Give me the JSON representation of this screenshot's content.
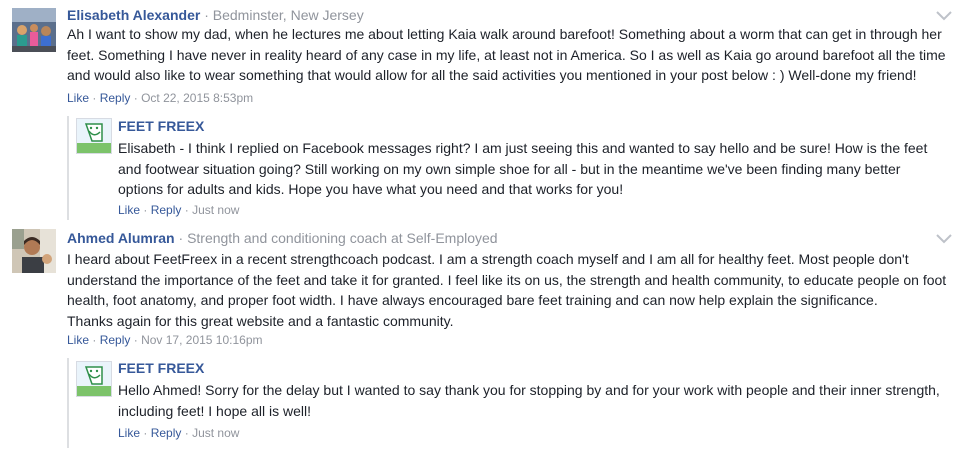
{
  "comments": [
    {
      "author": "Elisabeth Alexander",
      "separator": "·",
      "meta": "Bedminster, New Jersey",
      "text": "Ah I want to show my dad, when he lectures me about letting Kaia walk around barefoot! Something about a worm that can get in through her feet. Something I have never in reality heard of any case in my life, at least not in America. So I as well as Kaia go around barefoot all the time and would also like to wear something that would allow for all the said activities you mentioned in your post below : ) Well-done my friend!",
      "like_label": "Like",
      "reply_label": "Reply",
      "dot": "·",
      "timestamp": "Oct 22, 2015 8:53pm",
      "reply": {
        "author": "FEET FREEX",
        "text": "Elisabeth - I think I replied on Facebook messages right? I am just seeing this and wanted to say hello and be sure! How is the feet and footwear situation going? Still working on my own simple shoe for all - but in the meantime we've been finding many better options for adults and kids. Hope you have what you need and that works for you!",
        "like_label": "Like",
        "reply_label": "Reply",
        "dot": "·",
        "timestamp": "Just now"
      }
    },
    {
      "author": "Ahmed Alumran",
      "separator": "·",
      "meta": "Strength and conditioning coach at Self-Employed",
      "text": "I heard about FeetFreex in a recent strengthcoach podcast. I am a strength coach myself and I am all for healthy feet. Most people don't understand the importance of the feet and take it for granted. I feel like its on us, the strength and health community, to educate people on foot health, foot anatomy, and proper foot width. I have always encouraged bare feet training and can now help explain the significance.",
      "text2": "Thanks again for this great website and a fantastic community.",
      "like_label": "Like",
      "reply_label": "Reply",
      "dot": "·",
      "timestamp": "Nov 17, 2015 10:16pm",
      "reply": {
        "author": "FEET FREEX",
        "text": "Hello Ahmed! Sorry for the delay but I wanted to say thank you for stopping by and for your work with people and their inner strength, including feet! I hope all is well!",
        "like_label": "Like",
        "reply_label": "Reply",
        "dot": "·",
        "timestamp": "Just now"
      }
    }
  ],
  "colors": {
    "link": "#365899",
    "meta": "#90949c",
    "text": "#1d2129",
    "border": "#dddfe2"
  },
  "icons": {
    "menu": "chevron-down-icon"
  }
}
